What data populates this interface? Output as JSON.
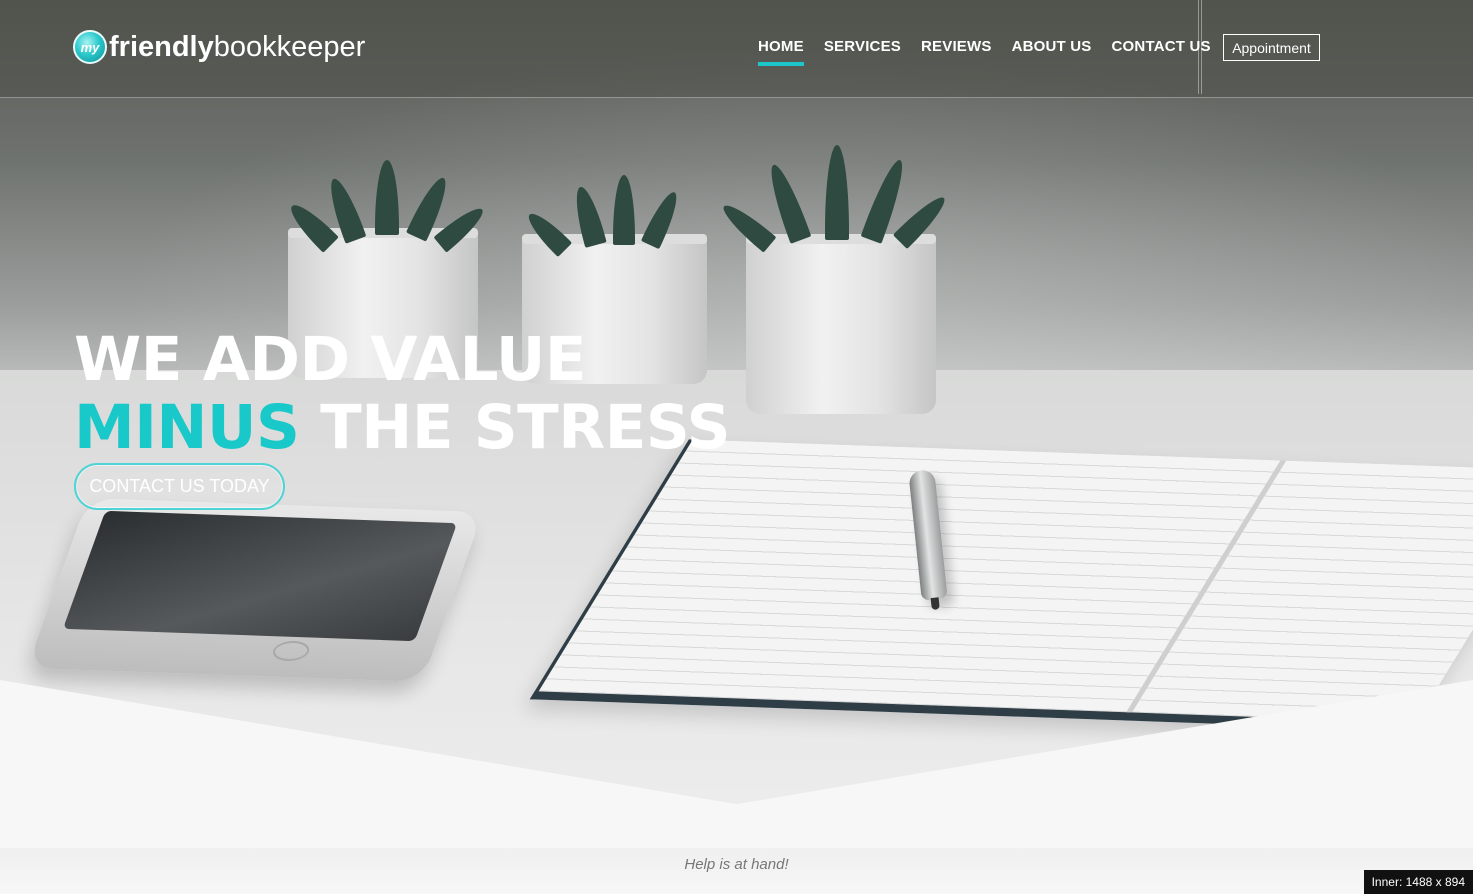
{
  "brand": {
    "logo_badge": "my",
    "logo_bold": "friendly",
    "logo_light": "bookkeeper",
    "accent_color": "#1cc6c9"
  },
  "nav": {
    "items": [
      {
        "label": "HOME",
        "active": true
      },
      {
        "label": "SERVICES",
        "active": false
      },
      {
        "label": "REVIEWS",
        "active": false
      },
      {
        "label": "ABOUT US",
        "active": false
      },
      {
        "label": "CONTACT US",
        "active": false
      }
    ],
    "appointment_label": "Appointment"
  },
  "hero": {
    "line1": "WE ADD VALUE",
    "line2_accent": "MINUS",
    "line2_rest": "THE STRESS",
    "cta_label": "CONTACT US TODAY"
  },
  "section": {
    "tagline": "Help is at hand!"
  },
  "overlay": {
    "inner_size": "Inner: 1488 x 894"
  }
}
